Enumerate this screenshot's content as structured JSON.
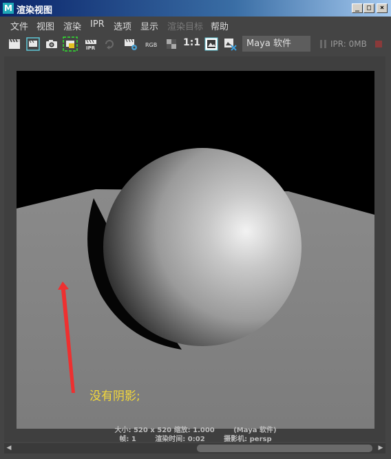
{
  "window": {
    "title": "渲染视图",
    "app_icon_letter": "M"
  },
  "window_controls": {
    "minimize": "_",
    "maximize": "□",
    "close": "×"
  },
  "menu": {
    "items": [
      "文件",
      "视图",
      "渲染",
      "IPR",
      "选项",
      "显示",
      "渲染目标",
      "帮助"
    ],
    "disabled": [
      "渲染目标"
    ]
  },
  "toolbar": {
    "rgb_label": "RGB",
    "ratio_label": "1:1",
    "renderer": "Maya 软件",
    "ipr_status": "IPR: 0MB",
    "icons": [
      "clapper-icon",
      "region-render-icon",
      "snapshot-camera-icon",
      "render-region-highlight-icon",
      "ipr-render-icon",
      "refresh-icon",
      "render-settings-icon",
      "rgb-channel-icon",
      "alpha-channel-icon",
      "keep-image-icon",
      "remove-image-icon",
      "pause-icon",
      "stop-icon"
    ]
  },
  "render": {
    "annotation": "没有阴影;",
    "info_line1": {
      "size": "大小: 520 x 520",
      "zoom": "缩放: 1.000",
      "renderer": "(Maya 软件)"
    },
    "info_line2": {
      "frame": "帧: 1",
      "time": "渲染时间: 0:02",
      "camera": "摄影机: persp"
    }
  },
  "colors": {
    "annotation": "#f4d93a",
    "arrow": "#ee3030",
    "title_bar_start": "#0a246a"
  }
}
